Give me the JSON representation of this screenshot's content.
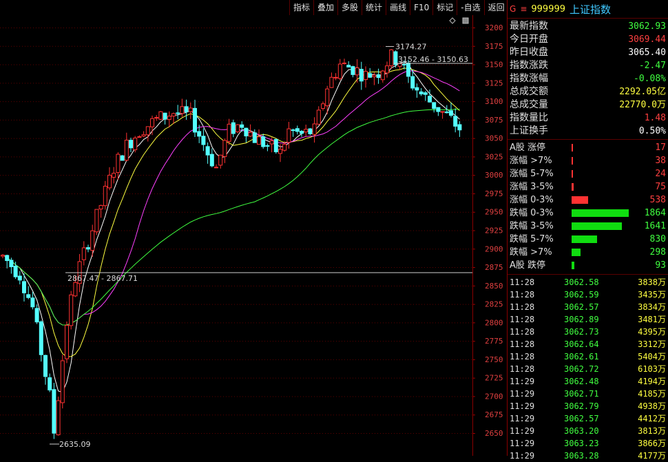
{
  "toolbar": {
    "buttons": [
      "指标",
      "叠加",
      "多股",
      "统计",
      "画线",
      "F10",
      "标记",
      "-自选",
      "返回"
    ]
  },
  "header": {
    "g_label": "G",
    "menu_glyph": "≡",
    "code": "999999",
    "name": "上证指数"
  },
  "stats": [
    {
      "label": "最新指数",
      "value": "3062.93",
      "color": "#40ff40"
    },
    {
      "label": "今日开盘",
      "value": "3069.44",
      "color": "#ff4040"
    },
    {
      "label": "昨日收盘",
      "value": "3065.40",
      "color": "#ffffff"
    },
    {
      "label": "指数涨跌",
      "value": "-2.47",
      "color": "#40ff40"
    },
    {
      "label": "指数涨幅",
      "value": "-0.08%",
      "color": "#40ff40"
    },
    {
      "label": "总成交额",
      "value": "2292.05亿",
      "color": "#ffff40"
    },
    {
      "label": "总成交量",
      "value": "22770.0万",
      "color": "#ffff40"
    },
    {
      "label": "指数量比",
      "value": "1.48",
      "color": "#ff4040"
    },
    {
      "label": "上证换手",
      "value": "0.50%",
      "color": "#ffffff"
    }
  ],
  "distribution": [
    {
      "label": "A股 涨停",
      "value": "17",
      "count": 17,
      "kind": "up"
    },
    {
      "label": "涨幅 >7%",
      "value": "38",
      "count": 38,
      "kind": "up"
    },
    {
      "label": "涨幅 5-7%",
      "value": "24",
      "count": 24,
      "kind": "up"
    },
    {
      "label": "涨幅 3-5%",
      "value": "75",
      "count": 75,
      "kind": "up"
    },
    {
      "label": "涨幅 0-3%",
      "value": "538",
      "count": 538,
      "kind": "up"
    },
    {
      "label": "跌幅 0-3%",
      "value": "1864",
      "count": 1864,
      "kind": "down"
    },
    {
      "label": "跌幅 3-5%",
      "value": "1641",
      "count": 1641,
      "kind": "down"
    },
    {
      "label": "跌幅 5-7%",
      "value": "830",
      "count": 830,
      "kind": "down"
    },
    {
      "label": "跌幅 >7%",
      "value": "298",
      "count": 298,
      "kind": "down"
    },
    {
      "label": "A股 跌停",
      "value": "93",
      "count": 93,
      "kind": "down"
    }
  ],
  "ticks": [
    {
      "time": "11:28",
      "price": "3062.58",
      "volume": "3838万"
    },
    {
      "time": "11:28",
      "price": "3062.59",
      "volume": "3435万"
    },
    {
      "time": "11:28",
      "price": "3062.57",
      "volume": "3834万"
    },
    {
      "time": "11:28",
      "price": "3062.89",
      "volume": "3481万"
    },
    {
      "time": "11:28",
      "price": "3062.73",
      "volume": "4395万"
    },
    {
      "time": "11:28",
      "price": "3062.64",
      "volume": "3312万"
    },
    {
      "time": "11:28",
      "price": "3062.61",
      "volume": "5404万"
    },
    {
      "time": "11:28",
      "price": "3062.72",
      "volume": "6103万"
    },
    {
      "time": "11:29",
      "price": "3062.48",
      "volume": "4194万"
    },
    {
      "time": "11:29",
      "price": "3062.71",
      "volume": "4185万"
    },
    {
      "time": "11:29",
      "price": "3062.79",
      "volume": "4938万"
    },
    {
      "time": "11:29",
      "price": "3062.57",
      "volume": "4412万"
    },
    {
      "time": "11:29",
      "price": "3063.20",
      "volume": "3813万"
    },
    {
      "time": "11:29",
      "price": "3063.23",
      "volume": "3866万"
    },
    {
      "time": "11:29",
      "price": "3063.28",
      "volume": "4177万"
    }
  ],
  "chart_data": {
    "type": "candlestick",
    "y_axis_ticks": [
      3200,
      3175,
      3150,
      3125,
      3100,
      3075,
      3050,
      3025,
      3000,
      2975,
      2950,
      2925,
      2900,
      2875,
      2850,
      2825,
      2800,
      2775,
      2750,
      2725,
      2700,
      2675,
      2650
    ],
    "ylim": [
      2630,
      3210
    ],
    "annotations": [
      {
        "text": "3174.27",
        "value": 3174.27
      },
      {
        "text": "3152.46 - 3150.63",
        "value": 3151.5
      },
      {
        "text": "2867.47 - 2867.71",
        "value": 2867.6
      },
      {
        "text": "2635.09",
        "value": 2635.09
      }
    ],
    "ma_series": [
      {
        "color": "#ffffff"
      },
      {
        "color": "#ffff40"
      },
      {
        "color": "#ff40ff"
      },
      {
        "color": "#40ff40"
      }
    ],
    "colors": {
      "up": "#ff3232",
      "down": "#54ffff"
    }
  }
}
